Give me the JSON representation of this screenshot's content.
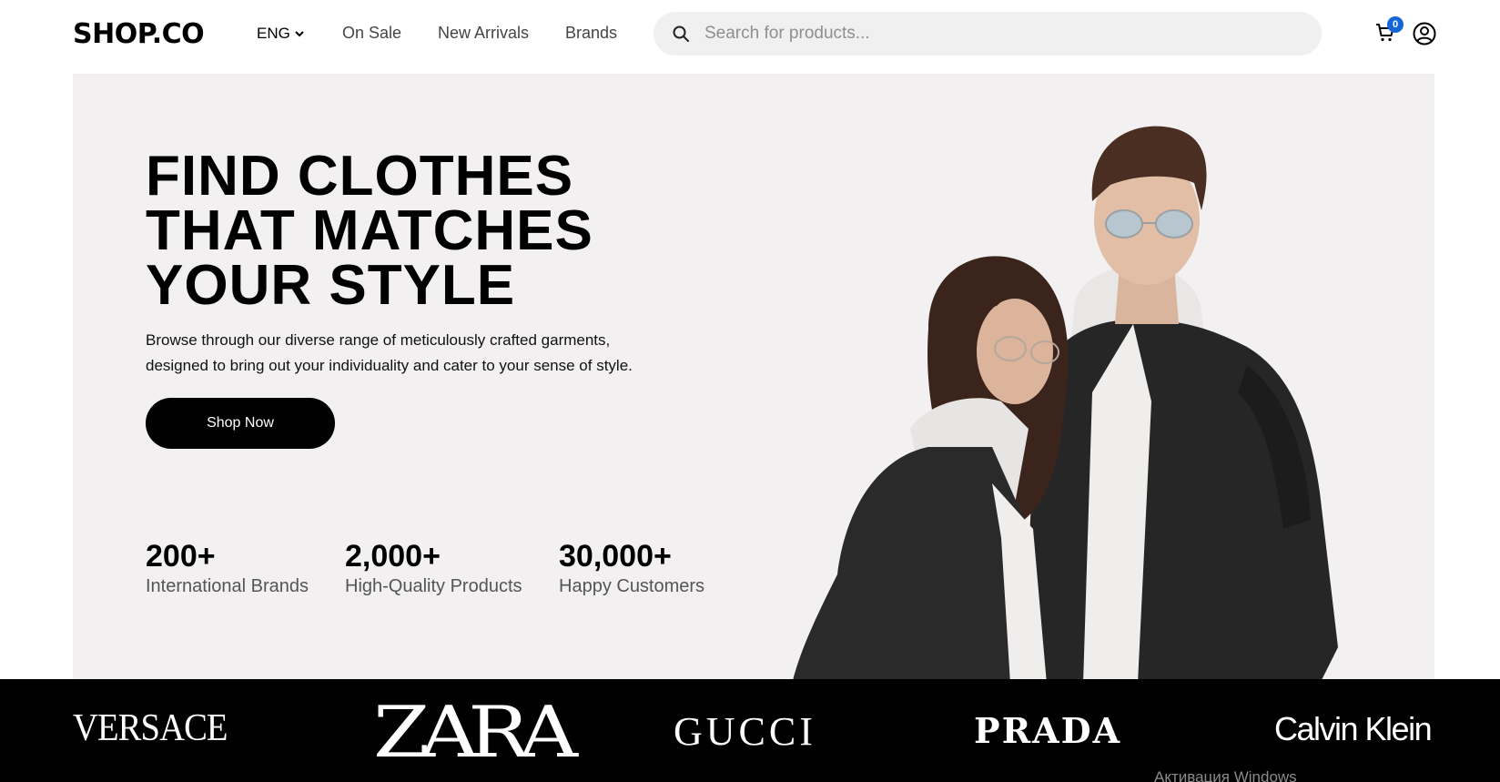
{
  "nav": {
    "logo": "SHOP.CO",
    "language": "ENG",
    "links": [
      "On Sale",
      "New Arrivals",
      "Brands"
    ],
    "search_placeholder": "Search for products...",
    "cart_count": "0",
    "icons": [
      "search-icon",
      "chevron-down-icon",
      "cart-icon",
      "account-icon"
    ]
  },
  "hero": {
    "title_lines": [
      "FIND CLOTHES",
      "THAT MATCHES",
      "YOUR STYLE"
    ],
    "subtitle_lines": [
      "Browse through our diverse range of meticulously crafted garments,",
      "designed to bring out your individuality and cater to your sense of style."
    ],
    "cta_label": "Shop Now",
    "stats": [
      {
        "value": "200+",
        "label": "International Brands"
      },
      {
        "value": "2,000+",
        "label": "High-Quality Products"
      },
      {
        "value": "30,000+",
        "label": "Happy Customers"
      }
    ]
  },
  "brands": [
    "VERSACE",
    "ZARA",
    "GUCCI",
    "PRADA",
    "Calvin Klein"
  ],
  "os_watermark": "Активация Windows",
  "colors": {
    "hero_bg": "#f2f0f1",
    "primary": "#000000",
    "badge": "#1565d8",
    "search_bg": "#f0f0f0"
  }
}
